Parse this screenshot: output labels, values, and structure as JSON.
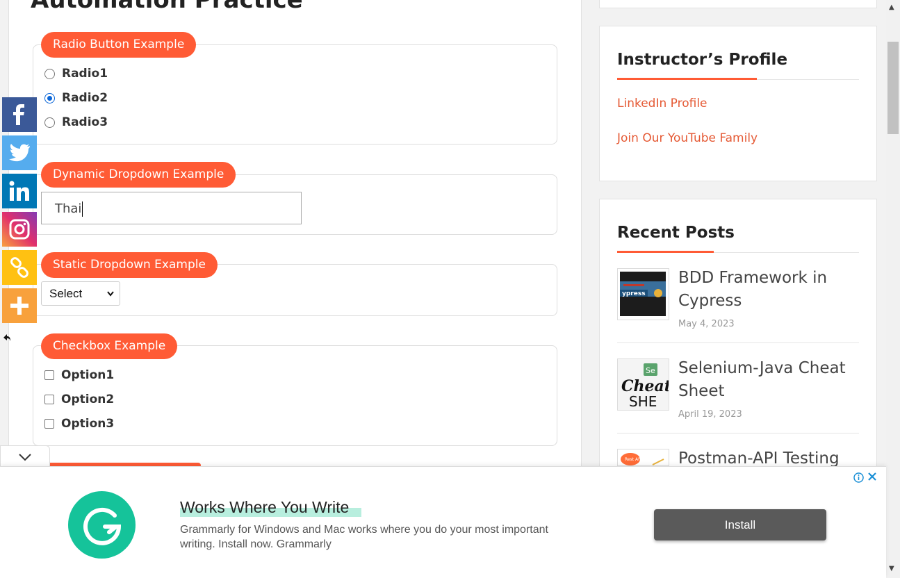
{
  "page": {
    "title": "Automation Practice"
  },
  "radio_section": {
    "legend": "Radio Button Example",
    "options": [
      {
        "label": "Radio1",
        "checked": false
      },
      {
        "label": "Radio2",
        "checked": true
      },
      {
        "label": "Radio3",
        "checked": false
      }
    ]
  },
  "dynamic_dropdown": {
    "legend": "Dynamic Dropdown Example",
    "value": "Thai"
  },
  "static_dropdown": {
    "legend": "Static Dropdown Example",
    "selected": "Select"
  },
  "checkbox_section": {
    "legend": "Checkbox Example",
    "options": [
      {
        "label": "Option1",
        "checked": false
      },
      {
        "label": "Option2",
        "checked": false
      },
      {
        "label": "Option3",
        "checked": false
      }
    ]
  },
  "share_bar": {
    "buttons": [
      {
        "name": "facebook",
        "color": "#3b5998"
      },
      {
        "name": "twitter",
        "color": "#55acee"
      },
      {
        "name": "linkedin",
        "color": "#0077b5"
      },
      {
        "name": "instagram",
        "color": "#c13584"
      },
      {
        "name": "copy-link",
        "color": "#ffc112"
      },
      {
        "name": "more",
        "color": "#f8a13c"
      }
    ]
  },
  "sidebar": {
    "instructor": {
      "heading": "Instructor’s Profile",
      "links": [
        "LinkedIn Profile",
        "Join Our YouTube Family"
      ]
    },
    "recent_posts": {
      "heading": "Recent Posts",
      "posts": [
        {
          "title": "BDD Framework in Cypress",
          "date": "May 4, 2023"
        },
        {
          "title": "Selenium-Java Cheat Sheet",
          "date": "April 19, 2023"
        },
        {
          "title": "Postman-API Testing for",
          "date": ""
        }
      ]
    }
  },
  "ad": {
    "title": "Works Where You Write",
    "description": "Grammarly for Windows and Mac works where you do your most important writing. Install now. Grammarly",
    "button": "Install",
    "brand_color": "#15c39a"
  },
  "colors": {
    "accent": "#ff5b35",
    "link": "#e55a35"
  }
}
